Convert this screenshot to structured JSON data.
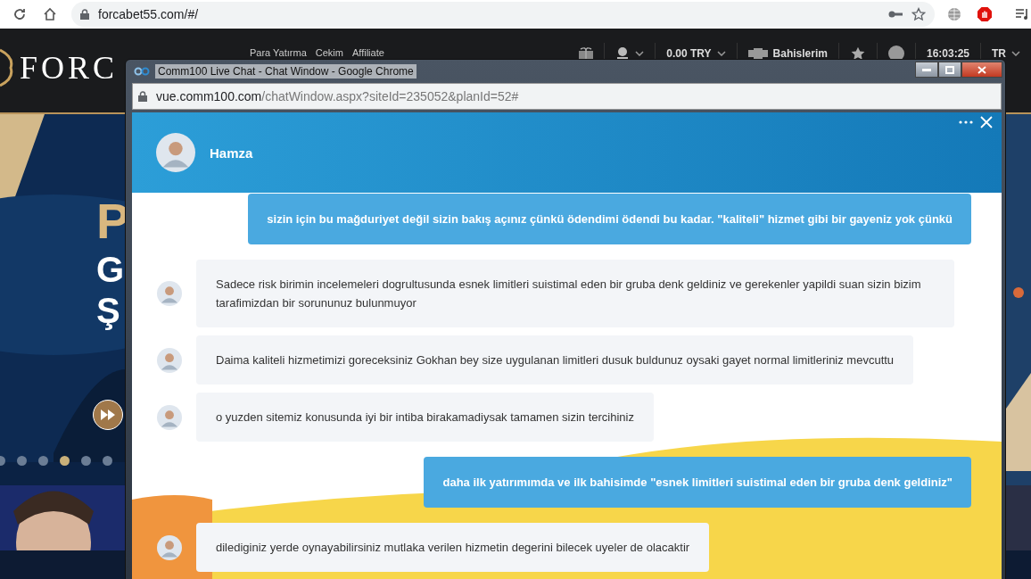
{
  "browser": {
    "url": "forcabet55.com/#/"
  },
  "site": {
    "logo": "FORC",
    "nav": [
      "Para Yatırma",
      "Cekim",
      "Affiliate"
    ],
    "balance": "0.00 TRY",
    "bets_label": "Bahislerim",
    "time": "16:03:25",
    "language": "TR",
    "hero_lines": [
      "P",
      "G",
      "Ş"
    ],
    "dots": [
      {
        "selected": false
      },
      {
        "selected": false
      },
      {
        "selected": false
      },
      {
        "selected": true
      },
      {
        "selected": false
      },
      {
        "selected": false
      }
    ]
  },
  "popup": {
    "title": "Comm100 Live Chat - Chat Window - Google Chrome",
    "url_host": "vue.comm100.com",
    "url_path": "/chatWindow.aspx?siteId=235052&planId=52#",
    "agent_name": "Hamza",
    "messages": [
      {
        "kind": "visitor",
        "text": "sizin için bu mağduriyet değil sizin bakış açınız çünkü ödendimi ödendi bu kadar. \"kaliteli\" hizmet gibi bir gayeniz yok çünkü"
      },
      {
        "kind": "agent",
        "text": "Sadece risk birimin incelemeleri dogrultusunda esnek limitleri suistimal eden bir gruba denk geldiniz ve gerekenler yapildi suan sizin bizim tarafimizdan bir sorununuz bulunmuyor"
      },
      {
        "kind": "agent",
        "text": "Daima kaliteli hizmetimizi goreceksiniz Gokhan bey size uygulanan limitleri dusuk buldunuz oysaki gayet normal limitleriniz mevcuttu"
      },
      {
        "kind": "agent",
        "text": "o yuzden sitemiz konusunda iyi bir intiba birakamadiysak tamamen sizin tercihiniz"
      },
      {
        "kind": "visitor",
        "text": "daha ilk yatırımımda ve ilk bahisimde \"esnek limitleri suistimal eden bir gruba denk geldiniz\""
      },
      {
        "kind": "agent",
        "text": "dilediginiz yerde oynayabilirsiniz mutlaka verilen hizmetin degerini bilecek uyeler de olacaktir"
      }
    ]
  }
}
